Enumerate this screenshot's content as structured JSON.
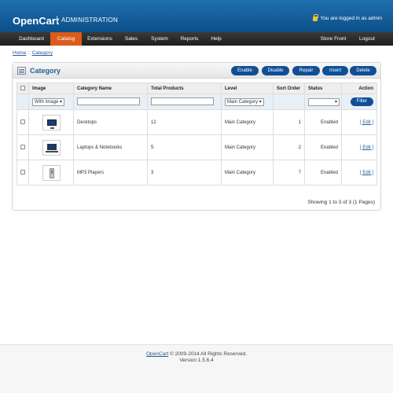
{
  "header": {
    "logo": "OpenCart",
    "admin_label": "ADMINISTRATION",
    "login_status": "You are logged in as admin"
  },
  "nav": {
    "dashboard": "Dashboard",
    "catalog": "Catalog",
    "extensions": "Extensions",
    "sales": "Sales",
    "system": "System",
    "reports": "Reports",
    "help": "Help",
    "store_front": "Store Front",
    "logout": "Logout"
  },
  "breadcrumb": {
    "home": "Home",
    "separator": "::",
    "current": "Category"
  },
  "box": {
    "title": "Category",
    "buttons": {
      "enable": "Enable",
      "disable": "Disable",
      "repair": "Repair",
      "insert": "Insert",
      "delete": "Delete"
    }
  },
  "table": {
    "headers": {
      "image": "Image",
      "category_name": "Category Name",
      "total_products": "Total Products",
      "level": "Level",
      "sort_order": "Sort Order",
      "status": "Status",
      "action": "Action"
    },
    "filter": {
      "image_select": "With Image",
      "level_select": "Main Category",
      "status_select": "",
      "filter_button": "Filter"
    },
    "rows": [
      {
        "name": "Desktops",
        "total": "12",
        "level": "Main Category",
        "sort": "1",
        "status": "Enabled",
        "action": "[ Edit ]",
        "icon": "desktop-icon"
      },
      {
        "name": "Laptops & Notebooks",
        "total": "5",
        "level": "Main Category",
        "sort": "2",
        "status": "Enabled",
        "action": "[ Edit ]",
        "icon": "laptop-icon"
      },
      {
        "name": "MP3 Players",
        "total": "3",
        "level": "Main Category",
        "sort": "7",
        "status": "Enabled",
        "action": "[ Edit ]",
        "icon": "mp3-player-icon"
      }
    ],
    "pagination": "Showing 1 to 3 of 3 (1 Pages)"
  },
  "footer": {
    "brand": "OpenCart",
    "copyright": "© 2009-2014 All Rights Reserved.",
    "version": "Version 1.5.6.4"
  },
  "colors": {
    "header_blue": "#0c4f88",
    "nav_active": "#dc5b1a",
    "button_blue": "#0f4f97",
    "title_blue": "#1f5e9c"
  }
}
